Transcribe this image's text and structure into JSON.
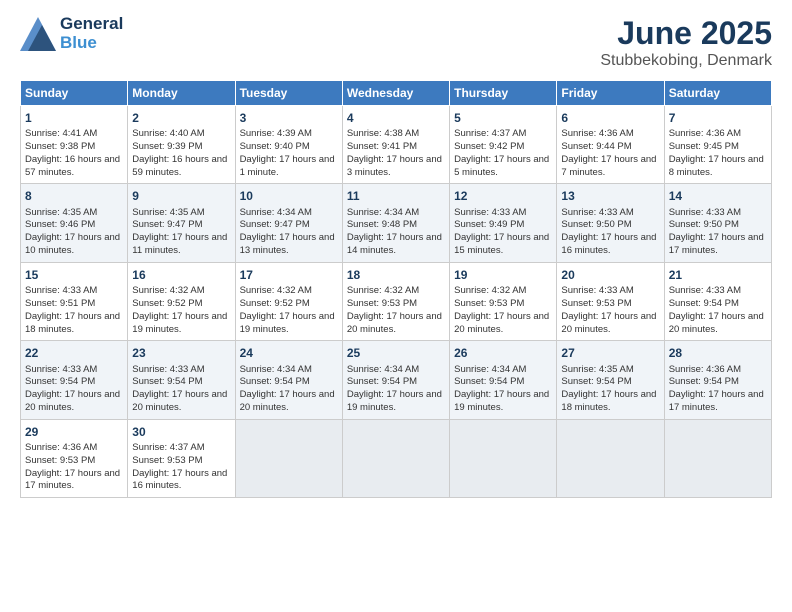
{
  "header": {
    "title": "June 2025",
    "subtitle": "Stubbekobing, Denmark",
    "logo_general": "General",
    "logo_blue": "Blue"
  },
  "days_of_week": [
    "Sunday",
    "Monday",
    "Tuesday",
    "Wednesday",
    "Thursday",
    "Friday",
    "Saturday"
  ],
  "weeks": [
    [
      {
        "day": "1",
        "sunrise": "Sunrise: 4:41 AM",
        "sunset": "Sunset: 9:38 PM",
        "daylight": "Daylight: 16 hours and 57 minutes."
      },
      {
        "day": "2",
        "sunrise": "Sunrise: 4:40 AM",
        "sunset": "Sunset: 9:39 PM",
        "daylight": "Daylight: 16 hours and 59 minutes."
      },
      {
        "day": "3",
        "sunrise": "Sunrise: 4:39 AM",
        "sunset": "Sunset: 9:40 PM",
        "daylight": "Daylight: 17 hours and 1 minute."
      },
      {
        "day": "4",
        "sunrise": "Sunrise: 4:38 AM",
        "sunset": "Sunset: 9:41 PM",
        "daylight": "Daylight: 17 hours and 3 minutes."
      },
      {
        "day": "5",
        "sunrise": "Sunrise: 4:37 AM",
        "sunset": "Sunset: 9:42 PM",
        "daylight": "Daylight: 17 hours and 5 minutes."
      },
      {
        "day": "6",
        "sunrise": "Sunrise: 4:36 AM",
        "sunset": "Sunset: 9:44 PM",
        "daylight": "Daylight: 17 hours and 7 minutes."
      },
      {
        "day": "7",
        "sunrise": "Sunrise: 4:36 AM",
        "sunset": "Sunset: 9:45 PM",
        "daylight": "Daylight: 17 hours and 8 minutes."
      }
    ],
    [
      {
        "day": "8",
        "sunrise": "Sunrise: 4:35 AM",
        "sunset": "Sunset: 9:46 PM",
        "daylight": "Daylight: 17 hours and 10 minutes."
      },
      {
        "day": "9",
        "sunrise": "Sunrise: 4:35 AM",
        "sunset": "Sunset: 9:47 PM",
        "daylight": "Daylight: 17 hours and 11 minutes."
      },
      {
        "day": "10",
        "sunrise": "Sunrise: 4:34 AM",
        "sunset": "Sunset: 9:47 PM",
        "daylight": "Daylight: 17 hours and 13 minutes."
      },
      {
        "day": "11",
        "sunrise": "Sunrise: 4:34 AM",
        "sunset": "Sunset: 9:48 PM",
        "daylight": "Daylight: 17 hours and 14 minutes."
      },
      {
        "day": "12",
        "sunrise": "Sunrise: 4:33 AM",
        "sunset": "Sunset: 9:49 PM",
        "daylight": "Daylight: 17 hours and 15 minutes."
      },
      {
        "day": "13",
        "sunrise": "Sunrise: 4:33 AM",
        "sunset": "Sunset: 9:50 PM",
        "daylight": "Daylight: 17 hours and 16 minutes."
      },
      {
        "day": "14",
        "sunrise": "Sunrise: 4:33 AM",
        "sunset": "Sunset: 9:50 PM",
        "daylight": "Daylight: 17 hours and 17 minutes."
      }
    ],
    [
      {
        "day": "15",
        "sunrise": "Sunrise: 4:33 AM",
        "sunset": "Sunset: 9:51 PM",
        "daylight": "Daylight: 17 hours and 18 minutes."
      },
      {
        "day": "16",
        "sunrise": "Sunrise: 4:32 AM",
        "sunset": "Sunset: 9:52 PM",
        "daylight": "Daylight: 17 hours and 19 minutes."
      },
      {
        "day": "17",
        "sunrise": "Sunrise: 4:32 AM",
        "sunset": "Sunset: 9:52 PM",
        "daylight": "Daylight: 17 hours and 19 minutes."
      },
      {
        "day": "18",
        "sunrise": "Sunrise: 4:32 AM",
        "sunset": "Sunset: 9:53 PM",
        "daylight": "Daylight: 17 hours and 20 minutes."
      },
      {
        "day": "19",
        "sunrise": "Sunrise: 4:32 AM",
        "sunset": "Sunset: 9:53 PM",
        "daylight": "Daylight: 17 hours and 20 minutes."
      },
      {
        "day": "20",
        "sunrise": "Sunrise: 4:33 AM",
        "sunset": "Sunset: 9:53 PM",
        "daylight": "Daylight: 17 hours and 20 minutes."
      },
      {
        "day": "21",
        "sunrise": "Sunrise: 4:33 AM",
        "sunset": "Sunset: 9:54 PM",
        "daylight": "Daylight: 17 hours and 20 minutes."
      }
    ],
    [
      {
        "day": "22",
        "sunrise": "Sunrise: 4:33 AM",
        "sunset": "Sunset: 9:54 PM",
        "daylight": "Daylight: 17 hours and 20 minutes."
      },
      {
        "day": "23",
        "sunrise": "Sunrise: 4:33 AM",
        "sunset": "Sunset: 9:54 PM",
        "daylight": "Daylight: 17 hours and 20 minutes."
      },
      {
        "day": "24",
        "sunrise": "Sunrise: 4:34 AM",
        "sunset": "Sunset: 9:54 PM",
        "daylight": "Daylight: 17 hours and 20 minutes."
      },
      {
        "day": "25",
        "sunrise": "Sunrise: 4:34 AM",
        "sunset": "Sunset: 9:54 PM",
        "daylight": "Daylight: 17 hours and 19 minutes."
      },
      {
        "day": "26",
        "sunrise": "Sunrise: 4:34 AM",
        "sunset": "Sunset: 9:54 PM",
        "daylight": "Daylight: 17 hours and 19 minutes."
      },
      {
        "day": "27",
        "sunrise": "Sunrise: 4:35 AM",
        "sunset": "Sunset: 9:54 PM",
        "daylight": "Daylight: 17 hours and 18 minutes."
      },
      {
        "day": "28",
        "sunrise": "Sunrise: 4:36 AM",
        "sunset": "Sunset: 9:54 PM",
        "daylight": "Daylight: 17 hours and 17 minutes."
      }
    ],
    [
      {
        "day": "29",
        "sunrise": "Sunrise: 4:36 AM",
        "sunset": "Sunset: 9:53 PM",
        "daylight": "Daylight: 17 hours and 17 minutes."
      },
      {
        "day": "30",
        "sunrise": "Sunrise: 4:37 AM",
        "sunset": "Sunset: 9:53 PM",
        "daylight": "Daylight: 17 hours and 16 minutes."
      },
      null,
      null,
      null,
      null,
      null
    ]
  ]
}
